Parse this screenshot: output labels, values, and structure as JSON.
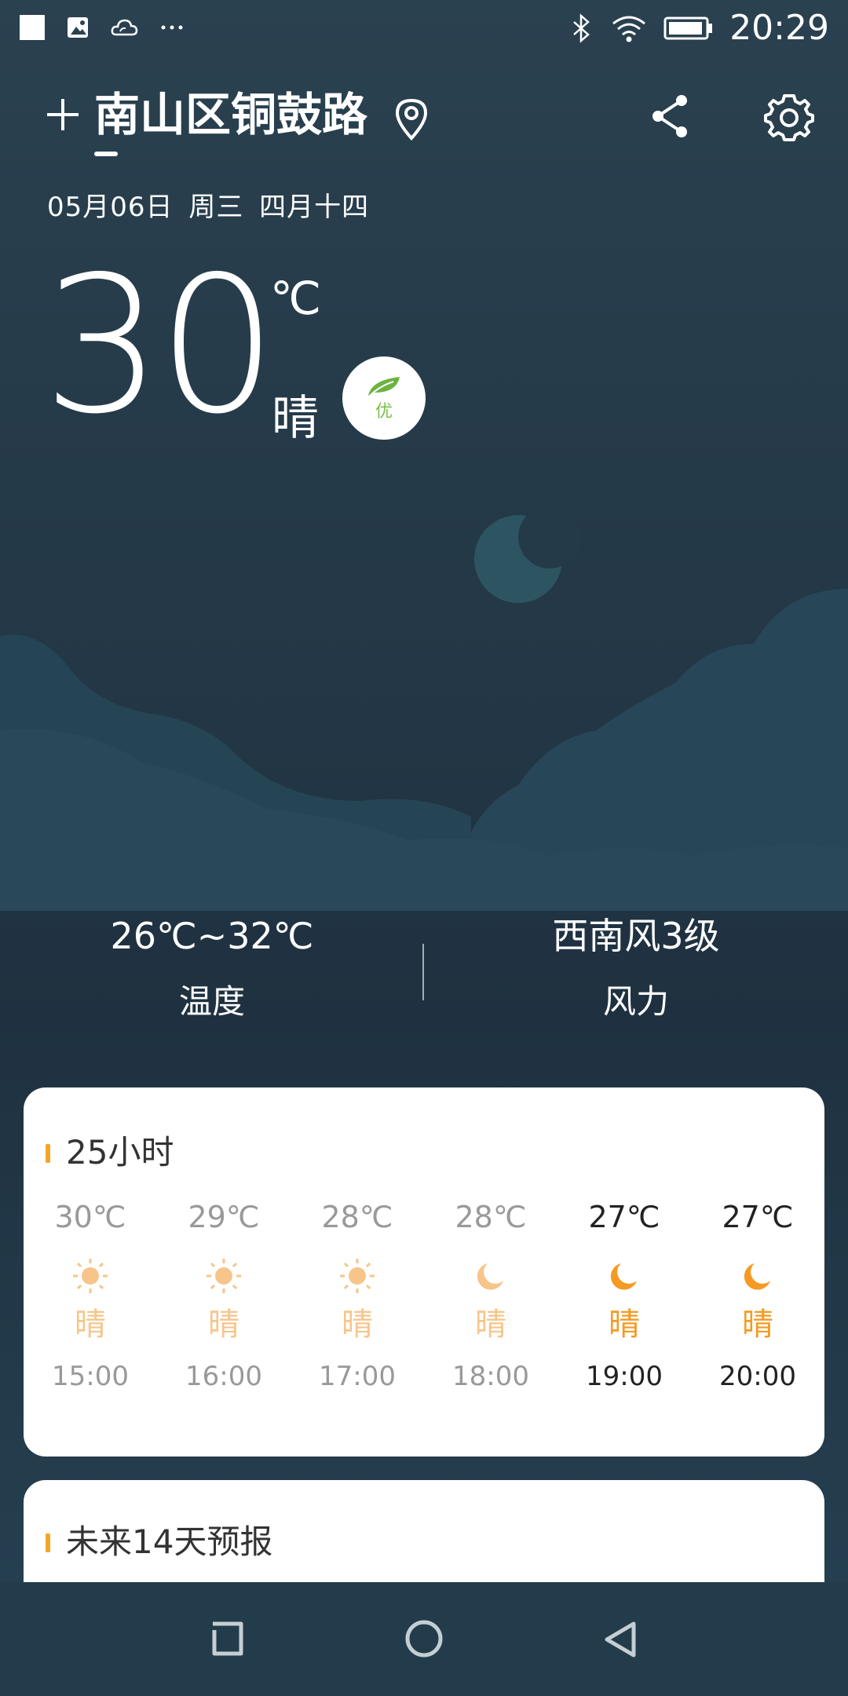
{
  "status_bar": {
    "time": "20:29",
    "left_icons": [
      "notification-square-icon",
      "image-icon",
      "weather-cloud-icon",
      "more-dots-icon"
    ],
    "right_icons": [
      "bluetooth-icon",
      "wifi-icon",
      "battery-icon"
    ]
  },
  "header": {
    "location": "南山区铜鼓路",
    "add_icon": "plus-icon",
    "pin_icon": "location-pin-icon",
    "share_icon": "share-icon",
    "settings_icon": "gear-icon"
  },
  "date_line": "05月06日 周三 四月十四",
  "current": {
    "temperature": "30",
    "unit": "℃",
    "condition": "晴",
    "aqi_label": "优",
    "aqi_color": "#7ac04a"
  },
  "stats": {
    "temp_range": "26℃~32℃",
    "temp_label": "温度",
    "wind": "西南风3级",
    "wind_label": "风力"
  },
  "hourly": {
    "title": "25小时",
    "items": [
      {
        "temp": "30℃",
        "cond": "晴",
        "time": "15:00",
        "icon": "sun-icon"
      },
      {
        "temp": "29℃",
        "cond": "晴",
        "time": "16:00",
        "icon": "sun-icon"
      },
      {
        "temp": "28℃",
        "cond": "晴",
        "time": "17:00",
        "icon": "sun-icon"
      },
      {
        "temp": "28℃",
        "cond": "晴",
        "time": "18:00",
        "icon": "moon-icon"
      },
      {
        "temp": "27℃",
        "cond": "晴",
        "time": "19:00",
        "icon": "moon-icon"
      },
      {
        "temp": "27℃",
        "cond": "晴",
        "time": "20:00",
        "icon": "moon-icon"
      }
    ]
  },
  "forecast": {
    "title": "未来14天预报"
  },
  "colors": {
    "accent": "#f5a623",
    "active_condition": "#f59a23",
    "past_condition": "#f7c58a"
  }
}
